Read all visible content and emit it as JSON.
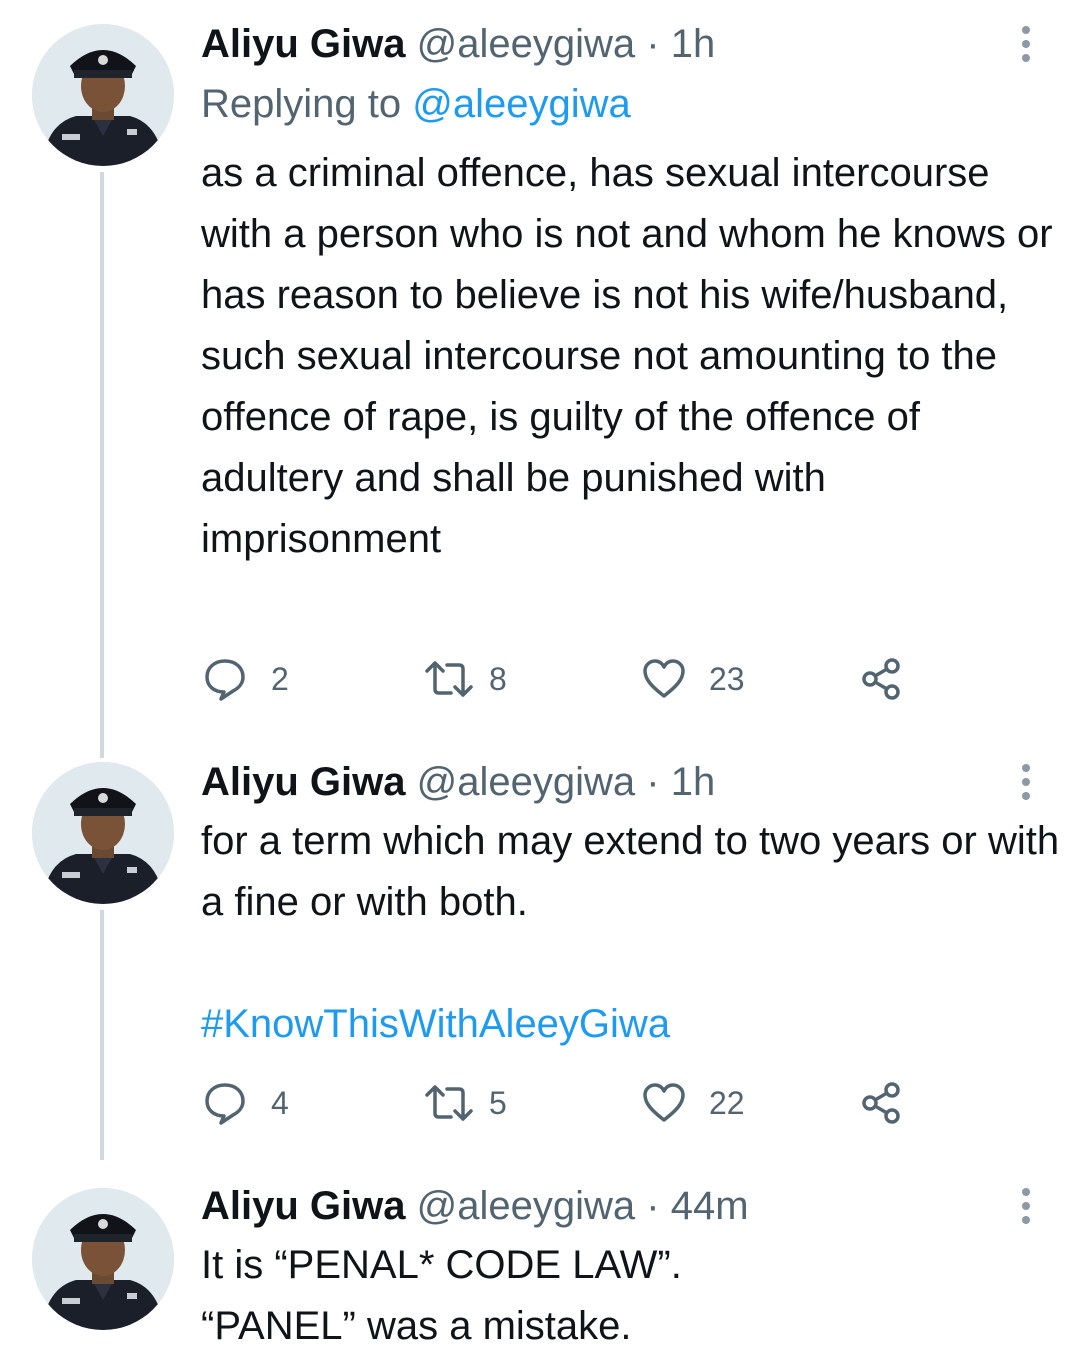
{
  "tweets": [
    {
      "name": "Aliyu Giwa",
      "handle": "@aleeygiwa",
      "separator": "·",
      "time": "1h",
      "replying_prefix": "Replying to ",
      "replying_to": "@aleeygiwa",
      "text": "as a criminal offence, has sexual intercourse with a person who is not and whom he knows or has reason to believe is not his wife/husband, such sexual intercourse not amounting to the offence of rape, is guilty of the offence of adultery and shall be punished with imprisonment",
      "replies": "2",
      "retweets": "8",
      "likes": "23"
    },
    {
      "name": "Aliyu Giwa",
      "handle": "@aleeygiwa",
      "separator": "·",
      "time": "1h",
      "text": "for a term which may extend to two years or with a fine or with both.",
      "hashtag": "#KnowThisWithAleeyGiwa",
      "replies": "4",
      "retweets": "5",
      "likes": "22"
    },
    {
      "name": "Aliyu Giwa",
      "handle": "@aleeygiwa",
      "separator": "·",
      "time": "44m",
      "text_line1": "It is “PENAL* CODE LAW”.",
      "text_line2": "“PANEL” was a mistake."
    }
  ],
  "icons": {
    "reply": "reply-icon",
    "retweet": "retweet-icon",
    "like": "heart-icon",
    "share": "share-icon",
    "more": "more-vertical-icon"
  },
  "colors": {
    "text": "#0f1419",
    "secondary": "#536471",
    "link": "#1d9bf0",
    "thread_line": "#cfd9de"
  }
}
